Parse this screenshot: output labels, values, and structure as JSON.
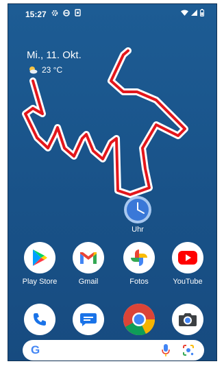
{
  "status": {
    "time": "15:27"
  },
  "widget": {
    "date": "Mi., 11. Okt.",
    "temperature": "23 °C"
  },
  "clock": {
    "label": "Uhr"
  },
  "apps": [
    {
      "label": "Play Store"
    },
    {
      "label": "Gmail"
    },
    {
      "label": "Fotos"
    },
    {
      "label": "YouTube"
    }
  ],
  "dock": [
    "phone-icon",
    "messages-icon",
    "chrome-icon",
    "camera-icon"
  ],
  "search": {
    "logo": "G"
  },
  "colors": {
    "wallpaper": "#1a5590",
    "annotation": "#e3161b"
  }
}
